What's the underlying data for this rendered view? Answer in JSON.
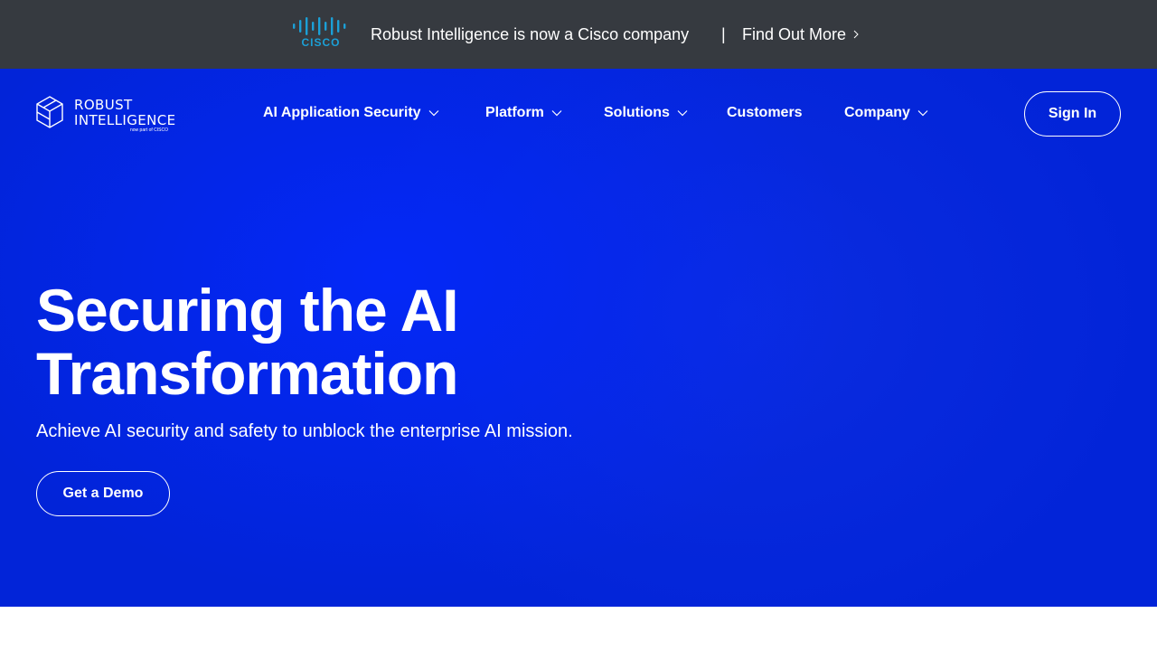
{
  "announcement": {
    "logo_text": "CISCO",
    "text": "Robust Intelligence is now a Cisco company",
    "separator": "|",
    "link_label": "Find Out More"
  },
  "brand": {
    "name": "ROBUST\nINTELLIGENCE",
    "sub": "now part of CISCO"
  },
  "nav": {
    "items": [
      {
        "label": "AI Application Security",
        "has_dropdown": true
      },
      {
        "label": "Platform",
        "has_dropdown": true
      },
      {
        "label": "Solutions",
        "has_dropdown": true
      },
      {
        "label": "Customers",
        "has_dropdown": false
      },
      {
        "label": "Company",
        "has_dropdown": true
      }
    ],
    "signin_label": "Sign In"
  },
  "hero": {
    "headline": "Securing the AI Transformation",
    "subline": "Achieve AI security and safety to unblock the enterprise AI mission.",
    "cta_label": "Get a Demo"
  },
  "colors": {
    "announce_bg": "#363a40",
    "hero_bg": "#0224d8",
    "cisco_blue": "#1ba0d7",
    "text": "#ffffff"
  },
  "icons": {
    "logo": "cisco-logo-icon",
    "brand": "cube-logo-icon",
    "caret": "chevron-down-icon",
    "arrow": "chevron-right-icon"
  }
}
